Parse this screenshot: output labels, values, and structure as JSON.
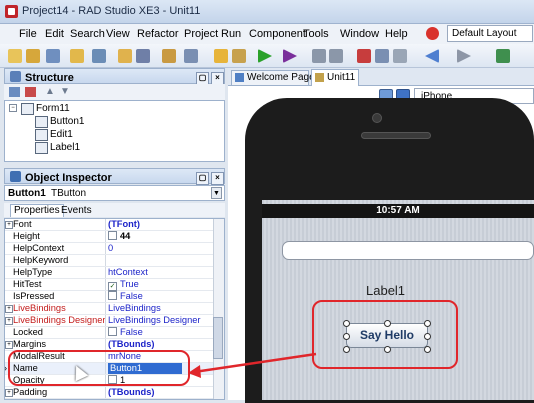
{
  "window": {
    "title": "Project14 - RAD Studio XE3 - Unit11"
  },
  "menu": {
    "items": [
      "File",
      "Edit",
      "Search",
      "View",
      "Refactor",
      "Project",
      "Run",
      "Component",
      "Tools",
      "Window",
      "Help"
    ],
    "layout_select": "Default Layout"
  },
  "structure": {
    "title": "Structure",
    "tree": [
      "Form11",
      "Button1",
      "Edit1",
      "Label1"
    ]
  },
  "inspector": {
    "title": "Object Inspector",
    "selected_name": "Button1",
    "selected_type": "TButton",
    "tabs": [
      "Properties",
      "Events"
    ],
    "rows": [
      {
        "name": "Font",
        "value": "(TFont)"
      },
      {
        "name": "Height",
        "value": "44"
      },
      {
        "name": "HelpContext",
        "value": "0"
      },
      {
        "name": "HelpKeyword",
        "value": ""
      },
      {
        "name": "HelpType",
        "value": "htContext"
      },
      {
        "name": "HitTest",
        "value": "True"
      },
      {
        "name": "IsPressed",
        "value": "False"
      },
      {
        "name": "LiveBindings",
        "value": "LiveBindings"
      },
      {
        "name": "LiveBindings Designer",
        "value": "LiveBindings Designer"
      },
      {
        "name": "Locked",
        "value": "False"
      },
      {
        "name": "Margins",
        "value": "(TBounds)"
      },
      {
        "name": "ModalResult",
        "value": "mrNone"
      },
      {
        "name": "Name",
        "value": "Button1"
      },
      {
        "name": "Opacity",
        "value": "1"
      },
      {
        "name": "Padding",
        "value": "(TBounds)"
      }
    ]
  },
  "editor": {
    "tabs": [
      "Welcome Page",
      "Unit11"
    ],
    "device": "iPhone"
  },
  "phone": {
    "time": "10:57 AM",
    "label_text": "Label1",
    "button_text": "Say Hello"
  },
  "colors": {
    "highlight": "#e0262b",
    "accent_blue": "#1d24c9"
  }
}
